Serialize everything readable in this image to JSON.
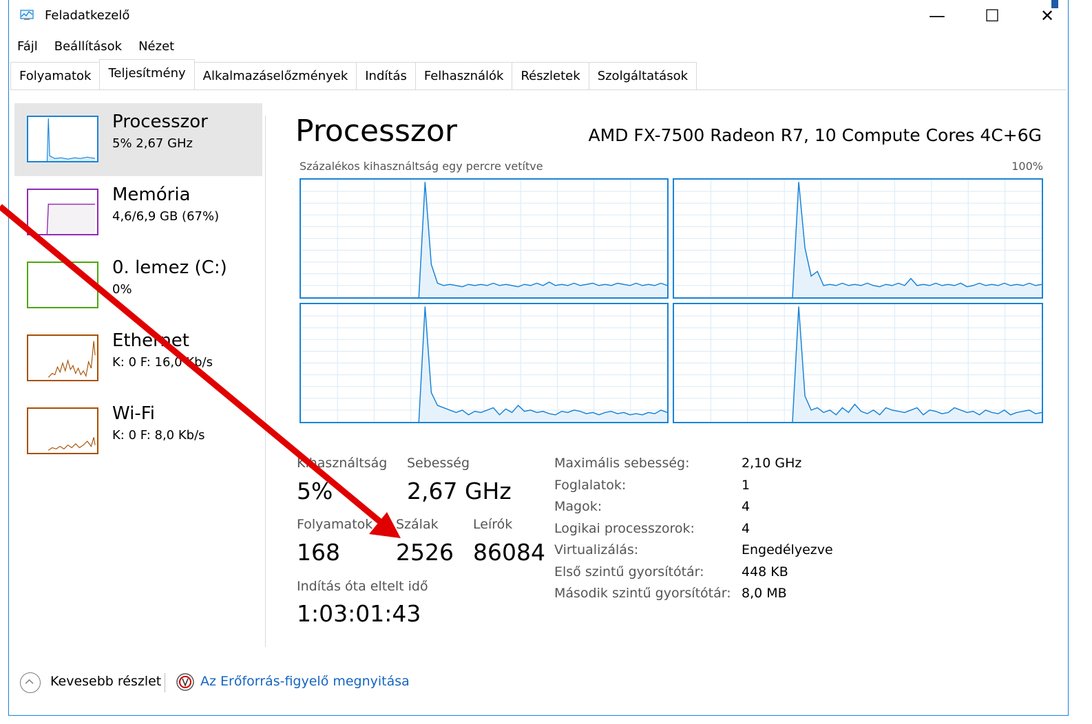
{
  "window": {
    "title": "Feladatkezelő",
    "controls": {
      "minimize": "—",
      "maximize": "☐",
      "close": "✕"
    }
  },
  "menu": [
    "Fájl",
    "Beállítások",
    "Nézet"
  ],
  "tabs": [
    {
      "label": "Folyamatok"
    },
    {
      "label": "Teljesítmény",
      "active": true
    },
    {
      "label": "Alkalmazáselőzmények"
    },
    {
      "label": "Indítás"
    },
    {
      "label": "Felhasználók"
    },
    {
      "label": "Részletek"
    },
    {
      "label": "Szolgáltatások"
    }
  ],
  "sidebar": {
    "items": [
      {
        "name": "Processzor",
        "sub": "5% 2,67 GHz",
        "color": "#1883d7"
      },
      {
        "name": "Memória",
        "sub": "4,6/6,9 GB (67%)",
        "color": "#9528b4"
      },
      {
        "name": "0. lemez (C:)",
        "sub": "0%",
        "color": "#4da60c"
      },
      {
        "name": "Ethernet",
        "sub": "K: 0 F: 16,0 Kb/s",
        "color": "#a74f01"
      },
      {
        "name": "Wi-Fi",
        "sub": "K: 0 F: 8,0 Kb/s",
        "color": "#a74f01"
      }
    ]
  },
  "main": {
    "title": "Processzor",
    "cpu_model": "AMD FX-7500 Radeon R7, 10 Compute Cores 4C+6G",
    "graph_label": "Százalékos kihasználtság egy percre vetítve",
    "graph_max": "100%",
    "stats": {
      "utilization_label": "Kihasználtság",
      "utilization": "5%",
      "speed_label": "Sebesség",
      "speed": "2,67 GHz",
      "processes_label": "Folyamatok",
      "processes": "168",
      "threads_label": "Szálak",
      "threads": "2526",
      "handles_label": "Leírók",
      "handles": "86084",
      "uptime_label": "Indítás óta eltelt idő",
      "uptime": "1:03:01:43"
    },
    "specs": [
      {
        "label": "Maximális sebesség:",
        "value": "2,10 GHz"
      },
      {
        "label": "Foglalatok:",
        "value": "1"
      },
      {
        "label": "Magok:",
        "value": "4"
      },
      {
        "label": "Logikai processzorok:",
        "value": "4"
      },
      {
        "label": "Virtualizálás:",
        "value": "Engedélyezve"
      },
      {
        "label": "Első szintű gyorsítótár:",
        "value": "448 KB"
      },
      {
        "label": "Második szintű gyorsítótár:",
        "value": "8,0 MB"
      }
    ]
  },
  "footer": {
    "less_details": "Kevesebb részlet",
    "resource_monitor": "Az Erőforrás-figyelő megnyitása"
  },
  "colors": {
    "accent": "#1883d7",
    "link": "#1565c0",
    "annotation_arrow": "#e00000"
  }
}
